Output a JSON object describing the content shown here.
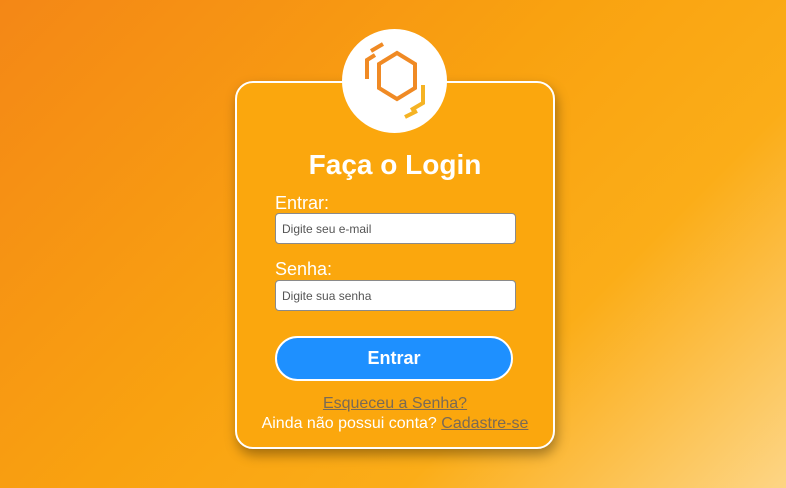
{
  "login": {
    "title": "Faça o Login",
    "email_label": "Entrar:",
    "email_placeholder": "Digite seu e-mail",
    "email_value": "",
    "password_label": "Senha:",
    "password_placeholder": "Digite sua senha",
    "password_value": "",
    "submit_label": "Entrar",
    "forgot_link": "Esqueceu a Senha?",
    "no_account_text": "Ainda não possui conta?",
    "signup_link": "Cadastre-se"
  },
  "logo": {
    "icon": "hexagon-logo-icon"
  },
  "colors": {
    "background_start": "#f48716",
    "background_end": "#fdd585",
    "card": "#fba70d",
    "button": "#1e90ff",
    "link": "#7a6a55",
    "logo_orange": "#f08a24"
  }
}
